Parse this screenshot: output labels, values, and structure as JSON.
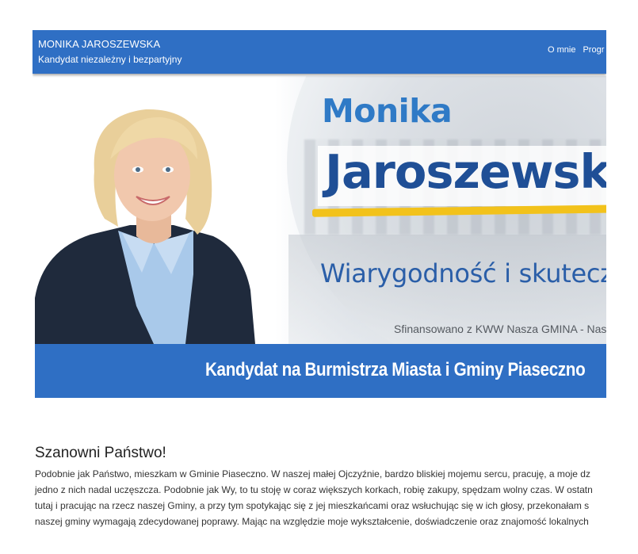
{
  "navbar": {
    "brand_name": "MONIKA JAROSZEWSKA",
    "brand_subtitle": "Kandydat niezależny i bezpartyjny",
    "links": [
      "O mnie",
      "Progr"
    ]
  },
  "hero": {
    "first_name": "Monika",
    "last_name": "Jaroszewsk",
    "slogan": "Wiarygodność i skuteczn",
    "disclaimer": "Sfinansowano z KWW Nasza GMINA - Nas",
    "band_text": "Kandydat na Burmistrza Miasta i Gminy Piaseczno"
  },
  "article": {
    "greeting": "Szanowni Państwo!",
    "lines": [
      "Podobnie jak Państwo, mieszkam w Gminie Piaseczno. W naszej małej Ojczyźnie, bardzo bliskiej mojemu sercu, pracuję, a moje dz",
      "jedno z nich nadal uczęszcza. Podobnie jak Wy, to tu stoję w coraz większych korkach, robię zakupy, spędzam wolny czas. W ostatn",
      "tutaj i pracując na rzecz naszej Gminy, a przy tym spotykając się z jej mieszkańcami oraz wsłuchując się w ich głosy, przekonałam s",
      "naszej gminy wymagają zdecydowanej poprawy. Mając na względzie moje wykształcenie, doświadczenie oraz znajomość lokalnych"
    ]
  },
  "colors": {
    "primary_blue": "#2f6fc4",
    "name_blue": "#2f7ac6",
    "dark_blue": "#1f4f96",
    "accent_yellow": "#f2c21b"
  }
}
